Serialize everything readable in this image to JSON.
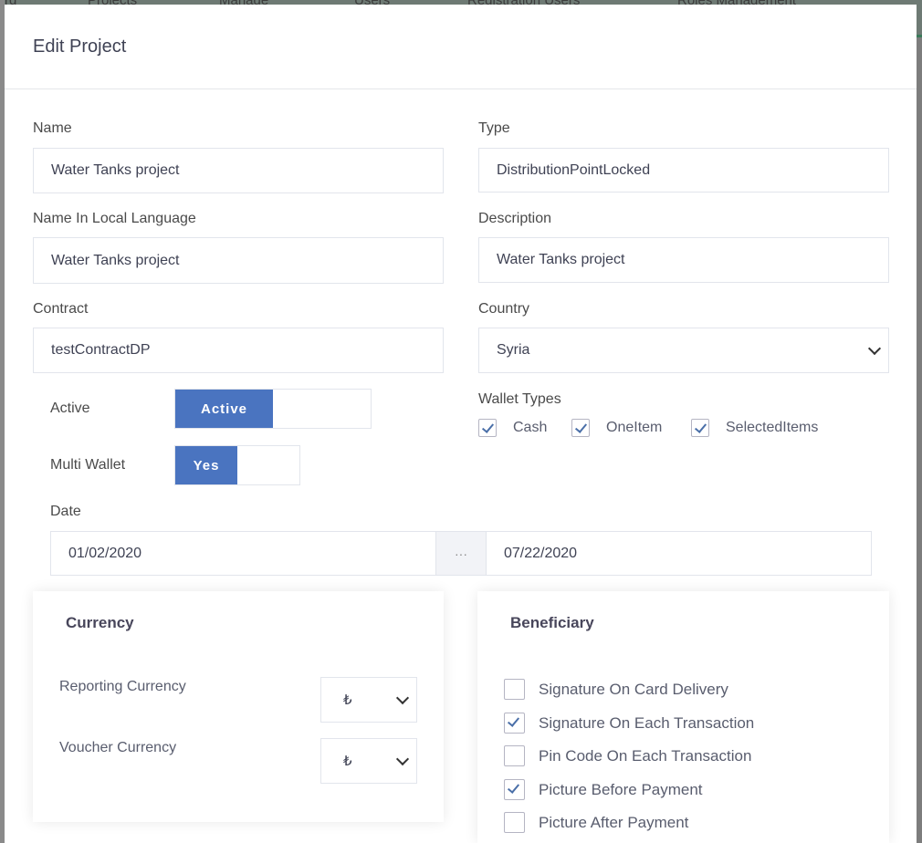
{
  "background_nav": [
    "rd",
    "Projects",
    "Manage",
    "Users",
    "Registration Users",
    "Roles Management"
  ],
  "modal": {
    "title": "Edit Project"
  },
  "form": {
    "name": {
      "label": "Name",
      "value": "Water Tanks project"
    },
    "type": {
      "label": "Type",
      "value": "DistributionPointLocked"
    },
    "name_local": {
      "label": "Name In Local Language",
      "value": "Water Tanks project"
    },
    "description": {
      "label": "Description",
      "value": "Water Tanks project"
    },
    "contract": {
      "label": "Contract",
      "value": "testContractDP"
    },
    "country": {
      "label": "Country",
      "value": "Syria"
    },
    "active": {
      "label": "Active",
      "toggle_label": "Active",
      "on": true
    },
    "multi_wallet": {
      "label": "Multi Wallet",
      "toggle_label": "Yes",
      "on": true
    },
    "wallet_types": {
      "label": "Wallet Types",
      "items": [
        {
          "label": "Cash",
          "checked": true
        },
        {
          "label": "OneItem",
          "checked": true
        },
        {
          "label": "SelectedItems",
          "checked": true
        }
      ]
    },
    "date": {
      "label": "Date",
      "start": "01/02/2020",
      "separator": "···",
      "end": "07/22/2020"
    }
  },
  "currency": {
    "title": "Currency",
    "reporting": {
      "label": "Reporting Currency",
      "value": "₺"
    },
    "voucher": {
      "label": "Voucher Currency",
      "value": "₺"
    }
  },
  "beneficiary": {
    "title": "Beneficiary",
    "items": [
      {
        "label": "Signature On Card Delivery",
        "checked": false
      },
      {
        "label": "Signature On Each Transaction",
        "checked": true
      },
      {
        "label": "Pin Code On Each Transaction",
        "checked": false
      },
      {
        "label": "Picture Before Payment",
        "checked": true
      },
      {
        "label": "Picture After Payment",
        "checked": false
      }
    ]
  },
  "colors": {
    "accent": "#4a74c0",
    "check": "#4a6fa8",
    "border": "#e2e5ec"
  }
}
